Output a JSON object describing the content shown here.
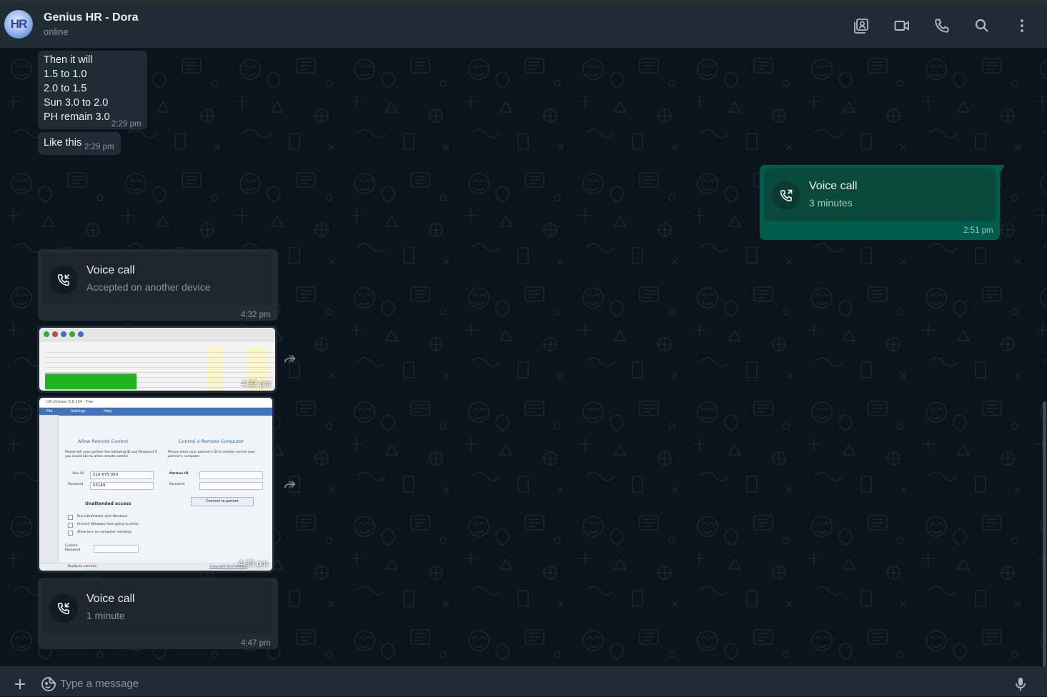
{
  "header": {
    "avatar_text": "HR",
    "contact_name": "Genius HR - Dora",
    "contact_status": "online",
    "icons": [
      "contact-card-icon",
      "video-call-icon",
      "phone-icon",
      "search-icon",
      "more-vertical-icon"
    ]
  },
  "messages": {
    "msg1": {
      "lines": [
        "Then it will",
        "1.5 to 1.0",
        "2.0 to 1.5",
        "Sun 3.0 to 2.0",
        "PH remain 3.0"
      ],
      "time": "2:29 pm"
    },
    "msg2": {
      "text": "Like this",
      "time": "2:29 pm"
    },
    "call_out": {
      "title": "Voice call",
      "subtitle": "3 minutes",
      "time": "2:51 pm"
    },
    "call_in1": {
      "title": "Voice call",
      "subtitle": "Accepted on another device",
      "time": "4:32 pm"
    },
    "image1": {
      "time": "4:32 pm"
    },
    "image2": {
      "time": "4:33 pm",
      "screen": {
        "window_title": "UltraViewer 6.6.104 - Free",
        "menu": [
          "File",
          "Settings",
          "Help"
        ],
        "allow_title": "Allow Remote Control",
        "allow_desc": "Please tell your partner the following ID and Password if you would like to allow remote control",
        "your_id_label": "Your ID",
        "your_id": "210 675 050",
        "password_label": "Password",
        "password": "55149",
        "control_title": "Control a Remote Computer",
        "control_desc": "Please enter your partner's ID to remote control your partner's computer",
        "partner_id_label": "Partner ID",
        "partner_password_label": "Password",
        "connect_button": "Connect to partner",
        "unattended": "Unattended access",
        "options": [
          "Run UltraViewer with Windows",
          "Prevent Windows from going to sleep",
          "Allow turn on computer remotely"
        ],
        "custom_password": "Custom Password",
        "status": "Ready to connect",
        "copyright": "Copyright DucFabulous"
      }
    },
    "call_in2": {
      "title": "Voice call",
      "subtitle": "1 minute",
      "time": "4:47 pm"
    }
  },
  "footer": {
    "placeholder": "Type a message",
    "icons": [
      "plus-icon",
      "sticker-icon",
      "microphone-icon"
    ]
  },
  "colors": {
    "header_bg": "#202c33",
    "chat_bg": "#0b141a",
    "incoming_bubble": "#202c33",
    "outgoing_bubble": "#005c4b",
    "primary_text": "#e9edef",
    "secondary_text": "#8696a0"
  }
}
